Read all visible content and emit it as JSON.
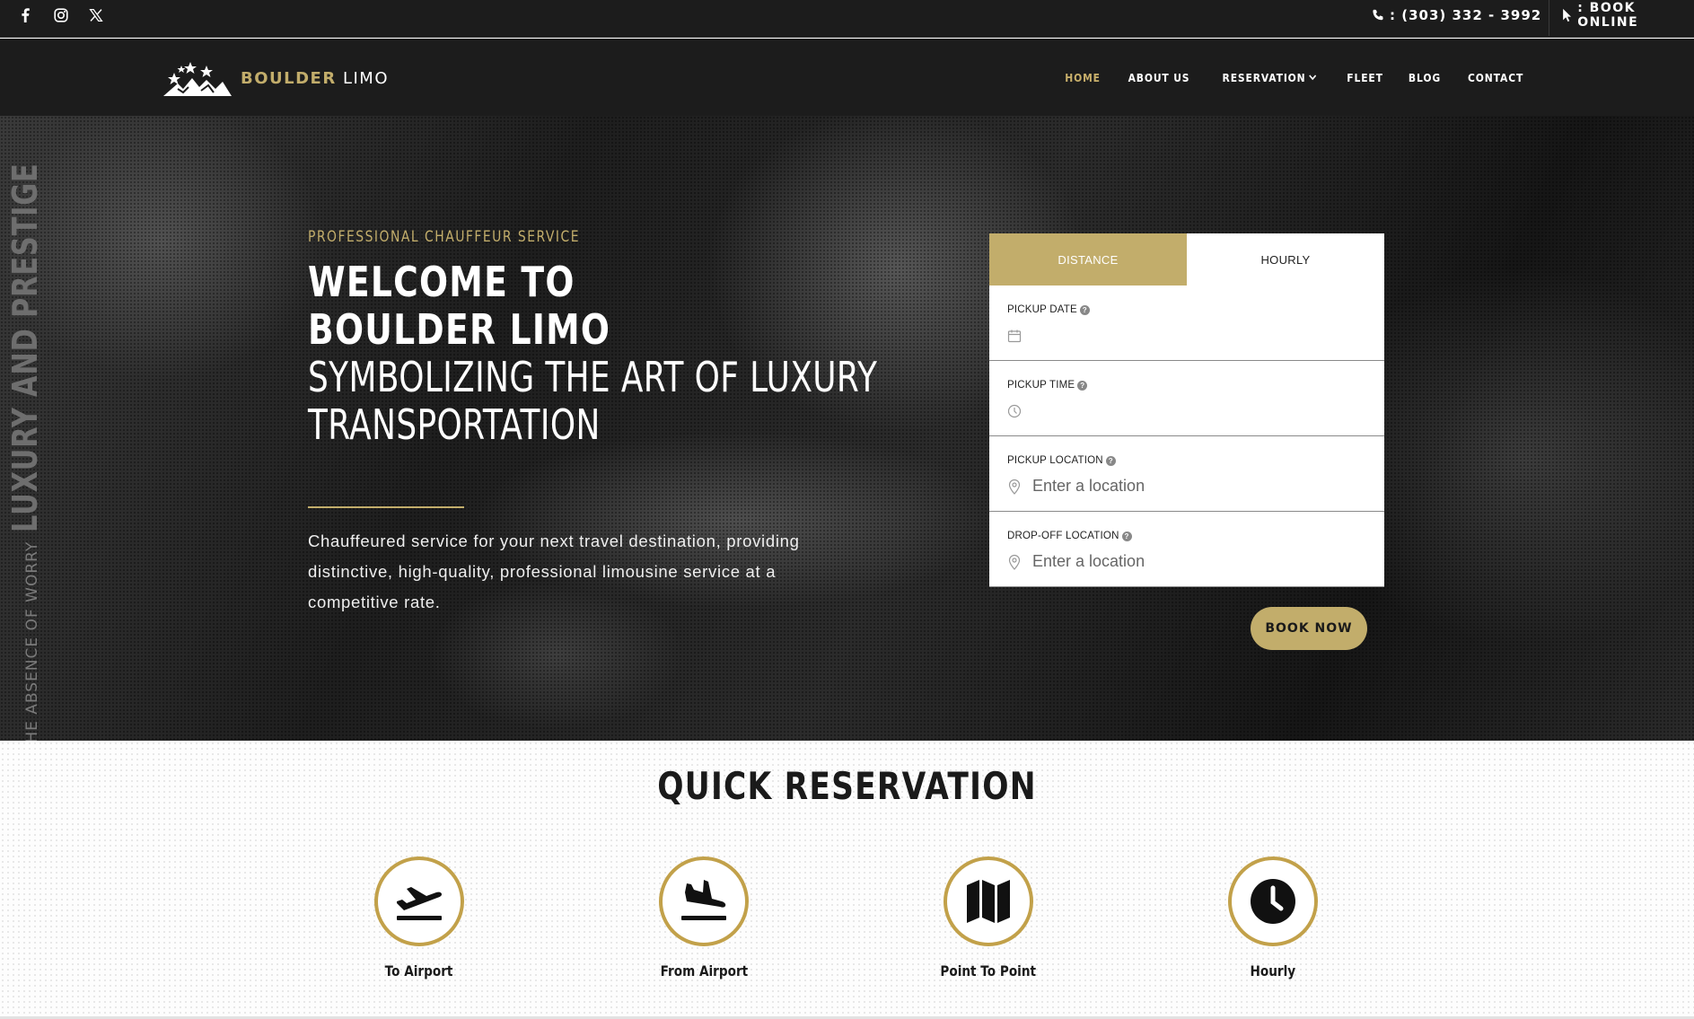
{
  "topbar": {
    "social": [
      {
        "name": "facebook"
      },
      {
        "name": "instagram"
      },
      {
        "name": "x"
      }
    ],
    "phone": ": (303) 332 - 3992",
    "book_online": ": BOOK ONLINE"
  },
  "brand": {
    "bold": "BOULDER",
    "light": "LIMO"
  },
  "nav": {
    "items": [
      "HOME",
      "ABOUT US",
      "RESERVATION",
      "FLEET",
      "BLOG",
      "CONTACT"
    ],
    "active": "HOME"
  },
  "hero": {
    "eyebrow": "PROFESSIONAL CHAUFFEUR SERVICE",
    "title_line1": "WELCOME TO",
    "title_line2": "BOULDER LIMO",
    "subtitle_line1": "SYMBOLIZING THE ART OF LUXURY",
    "subtitle_line2": "TRANSPORTATION",
    "description": "Chauffeured service for your next travel destination, providing distinctive, high-quality, professional limousine service at a competitive rate.",
    "vertical_small": "THE ABSENCE OF WORRY",
    "vertical_big": "LUXURY AND PRESTIGE"
  },
  "booking": {
    "tabs": [
      "DISTANCE",
      "HOURLY"
    ],
    "active_tab": "DISTANCE",
    "fields": {
      "pickup_date": {
        "label": "PICKUP DATE",
        "value": ""
      },
      "pickup_time": {
        "label": "PICKUP TIME",
        "value": ""
      },
      "pickup_location": {
        "label": "PICKUP LOCATION",
        "placeholder": "Enter a location"
      },
      "dropoff_location": {
        "label": "DROP-OFF LOCATION",
        "placeholder": "Enter a location"
      }
    },
    "submit": "BOOK NOW"
  },
  "quick_reservation": {
    "title": "QUICK RESERVATION",
    "items": [
      {
        "label": "To Airport",
        "icon": "plane-departure-icon"
      },
      {
        "label": "From Airport",
        "icon": "plane-arrival-icon"
      },
      {
        "label": "Point To Point",
        "icon": "map-icon"
      },
      {
        "label": "Hourly",
        "icon": "clock-icon"
      }
    ]
  },
  "colors": {
    "gold": "#c2ad6b",
    "dark": "#1c1c1c",
    "ring": "#c2a14a"
  }
}
